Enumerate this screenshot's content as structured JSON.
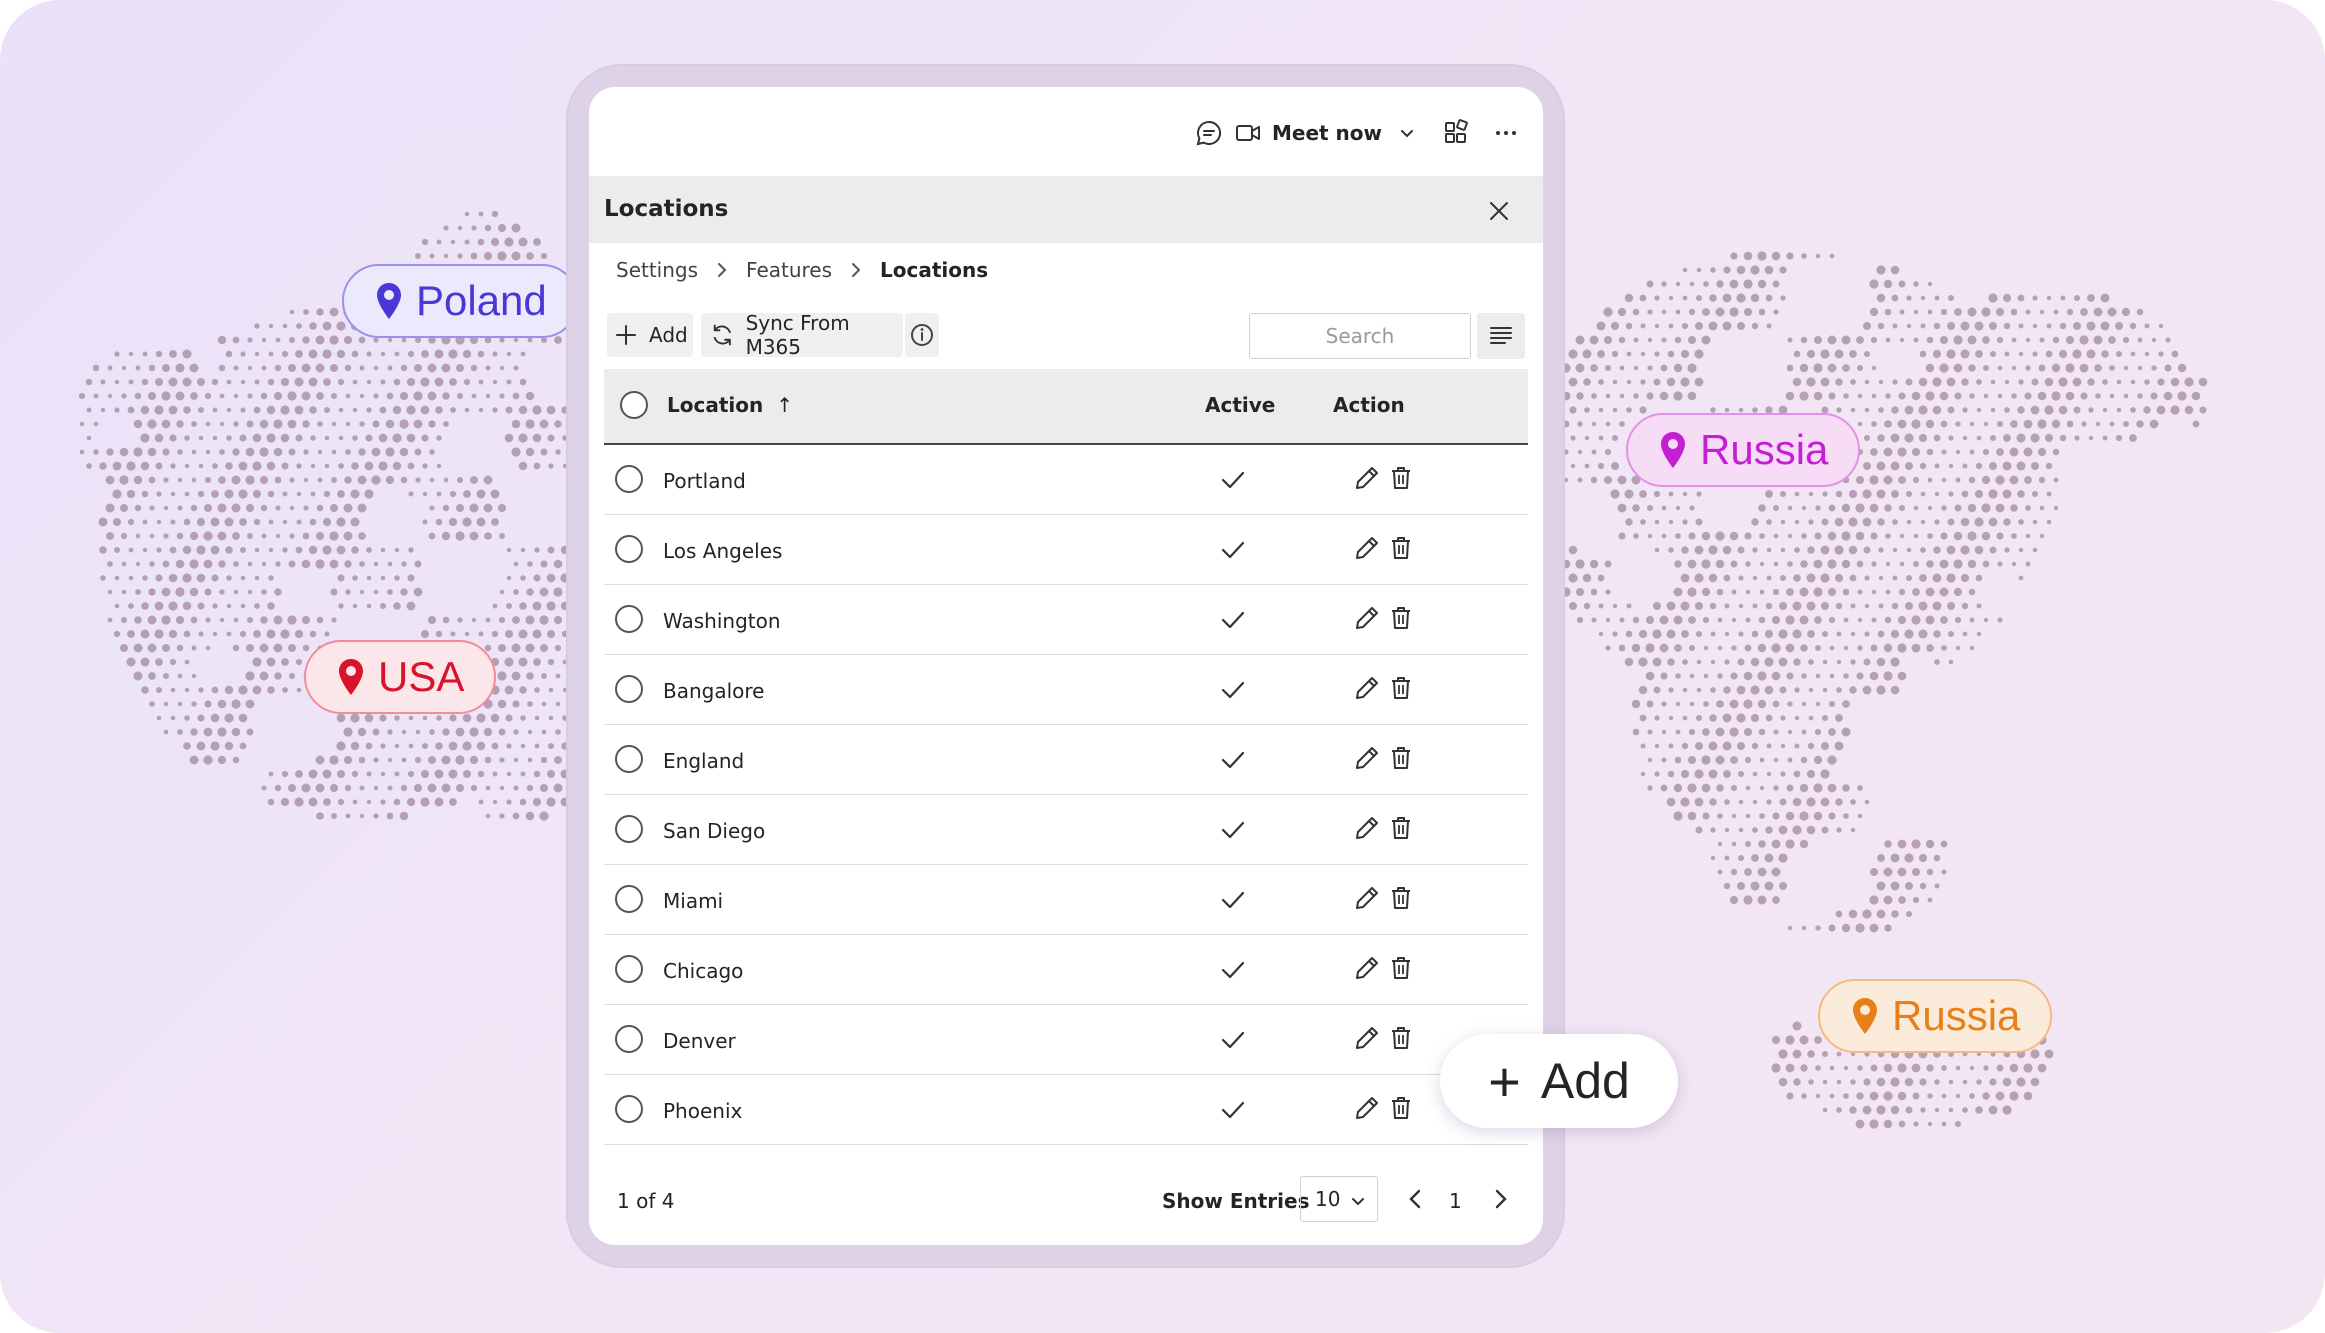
{
  "topbar": {
    "meet_label": "Meet now"
  },
  "panel": {
    "title": "Locations"
  },
  "breadcrumb": {
    "items": [
      "Settings",
      "Features",
      "Locations"
    ]
  },
  "toolbar": {
    "add_label": "Add",
    "sync_label": "Sync From M365",
    "search_placeholder": "Search"
  },
  "table": {
    "columns": {
      "location": "Location",
      "sort_arrow": "↑",
      "active": "Active",
      "action": "Action"
    },
    "rows": [
      {
        "name": "Portland"
      },
      {
        "name": "Los Angeles"
      },
      {
        "name": "Washington"
      },
      {
        "name": "Bangalore"
      },
      {
        "name": "England"
      },
      {
        "name": "San Diego"
      },
      {
        "name": "Miami"
      },
      {
        "name": "Chicago"
      },
      {
        "name": "Denver"
      },
      {
        "name": "Phoenix"
      }
    ]
  },
  "footer": {
    "page_count": "1 of 4",
    "show_entries_label": "Show Entries",
    "entries_value": "10",
    "current_page": "1"
  },
  "pills": [
    {
      "label": "Poland",
      "color": "#4a38d6",
      "bg": "#ebe9fb"
    },
    {
      "label": "USA",
      "color": "#d8132b",
      "bg": "#fbe6ea"
    },
    {
      "label": "Russia",
      "color": "#c51fd6",
      "bg": "#f7dcf6"
    },
    {
      "label": "Russia",
      "color": "#e8801a",
      "bg": "#fbebdb"
    }
  ],
  "float_add": {
    "label": "Add"
  },
  "icons": [
    "chat-icon",
    "video-icon",
    "chevron-down-icon",
    "apps-icon",
    "more-icon",
    "close-icon",
    "chevron-right-icon",
    "plus-icon",
    "sync-icon",
    "info-icon",
    "list-view-icon",
    "radio-icon",
    "checkmark-icon",
    "pencil-icon",
    "trash-icon",
    "chevron-left-icon",
    "location-pin-icon"
  ]
}
